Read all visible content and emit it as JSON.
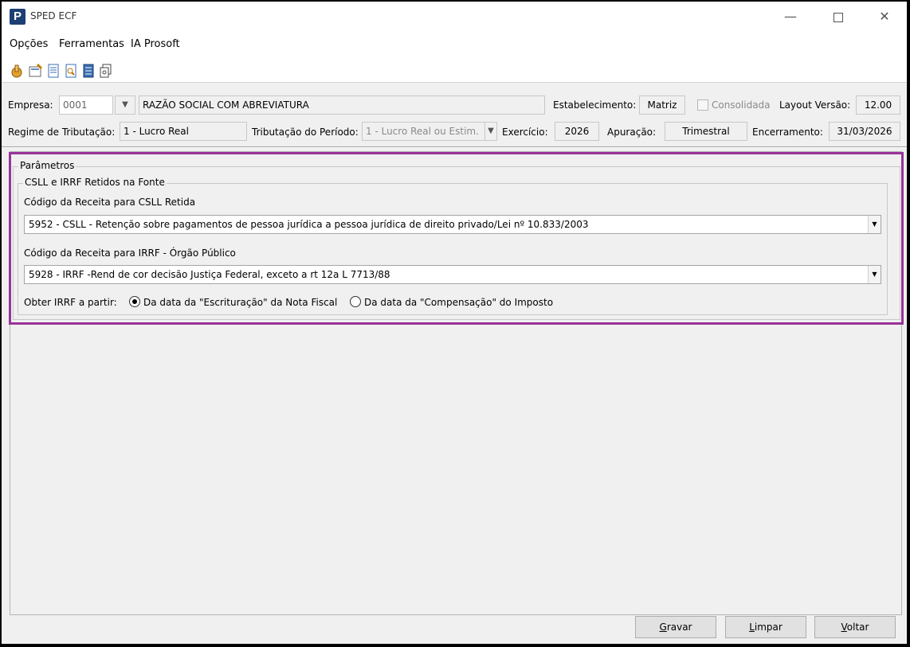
{
  "window": {
    "title": "SPED ECF",
    "minimize": "—",
    "close": "✕"
  },
  "menu": [
    "Opções",
    "Ferramentas",
    "IA Prosoft"
  ],
  "toolbar_icons": [
    "hand-icon",
    "settings-icon",
    "document-icon",
    "search-document-icon",
    "report-icon",
    "copy-icon"
  ],
  "header": {
    "empresa_label": "Empresa:",
    "empresa_code": "0001",
    "empresa_name": "RAZÃO SOCIAL COM ABREVIATURA",
    "estabelecimento_label": "Estabelecimento:",
    "estabelecimento_value": "Matriz",
    "consolidada_label": "Consolidada",
    "layout_label": "Layout Versão:",
    "layout_value": "12.00",
    "regime_label": "Regime de Tributação:",
    "regime_value": "1 - Lucro Real",
    "trib_periodo_label": "Tributação do Período:",
    "trib_periodo_value": "1 - Lucro Real ou Estim.",
    "exercicio_label": "Exercício:",
    "exercicio_value": "2026",
    "apuracao_label": "Apuração:",
    "apuracao_value": "Trimestral",
    "encerramento_label": "Encerramento:",
    "encerramento_value": "31/03/2026"
  },
  "params": {
    "group_title": "Parâmetros",
    "subgroup_title": "CSLL e IRRF Retidos na Fonte",
    "csll_label": "Código da Receita para CSLL Retida",
    "csll_value": "5952 - CSLL - Retenção sobre pagamentos de pessoa jurídica a pessoa jurídica de direito privado/Lei nº 10.833/2003",
    "irrf_label": "Código da Receita para IRRF -  Órgão Público",
    "irrf_value": "5928 - IRRF -Rend de cor decisão Justiça Federal, exceto a rt 12a L 7713/88",
    "obter_label": "Obter IRRF a partir:",
    "radio_escrituracao": "Da data da \"Escrituração\" da Nota Fiscal",
    "radio_compensacao": "Da data da \"Compensação\" do Imposto",
    "selected_radio": "escrituracao"
  },
  "buttons": {
    "gravar_first": "G",
    "gravar_rest": "ravar",
    "limpar_first": "L",
    "limpar_rest": "impar",
    "voltar_first": "V",
    "voltar_rest": "oltar"
  }
}
